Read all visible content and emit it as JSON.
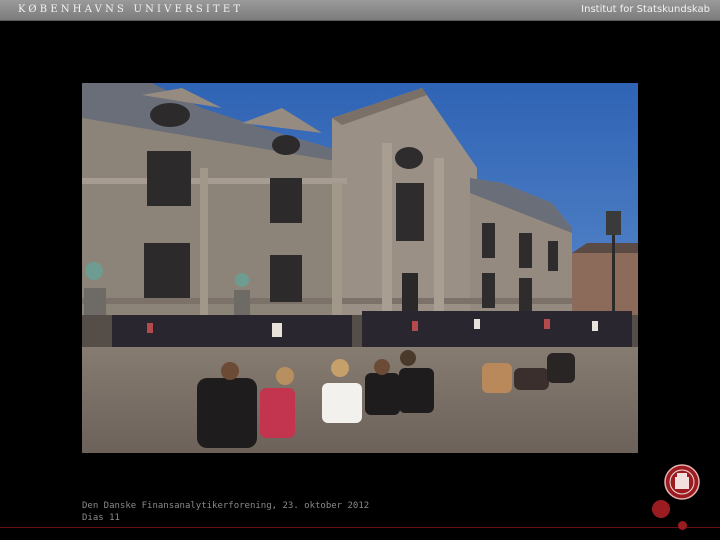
{
  "header": {
    "university": "KØBENHAVNS UNIVERSITET",
    "department": "Institut for Statskundskab"
  },
  "footer": {
    "event": "Den Danske Finansanalytikerforening, 23. oktober 2012",
    "slide": "Dias 11"
  },
  "colors": {
    "accent_red": "#9b1c20",
    "header_gray": "#8c8c8c",
    "background": "#000000"
  },
  "icons": {
    "seal": "university-seal-icon"
  }
}
